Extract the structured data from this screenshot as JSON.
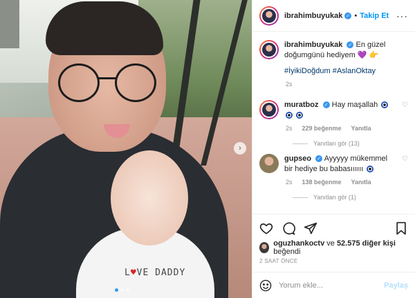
{
  "header": {
    "username": "ibrahimbuyukak",
    "separator": "•",
    "follow_label": "Takip Et",
    "more_label": "···"
  },
  "caption": {
    "username": "ibrahimbuyukak",
    "text": "En güzel doğumgünü hediyem",
    "hashtags": "#İyikiDoğdum #AslanOktay",
    "time": "2s"
  },
  "comments": [
    {
      "username": "muratboz",
      "text": "Hay maşallah",
      "time": "2s",
      "likes": "229 beğenme",
      "reply_label": "Yanıtla",
      "view_replies": "Yanıtları gör (13)"
    },
    {
      "username": "gupseo",
      "text": "Ayyyyy mükemmel bir hediye bu babasıııııı",
      "time": "2s",
      "likes": "138 beğenme",
      "reply_label": "Yanıtla",
      "view_replies": "Yanıtları gör (1)"
    }
  ],
  "likes": {
    "user": "oguzhankoctv",
    "connector": "ve",
    "others": "52.575 diğer kişi",
    "suffix": "beğendi"
  },
  "post_age": "2 SAAT ÖNCE",
  "comment_box": {
    "placeholder": "Yorum ekle...",
    "post_label": "Paylaş"
  },
  "photo": {
    "onesie_left": "L",
    "onesie_heart": "♥",
    "onesie_right": "VE DADDY",
    "next_arrow": "›"
  },
  "colors": {
    "accent": "#0095f6",
    "verified": "#3897f0",
    "muted": "#8e8e8e",
    "text": "#262626"
  }
}
